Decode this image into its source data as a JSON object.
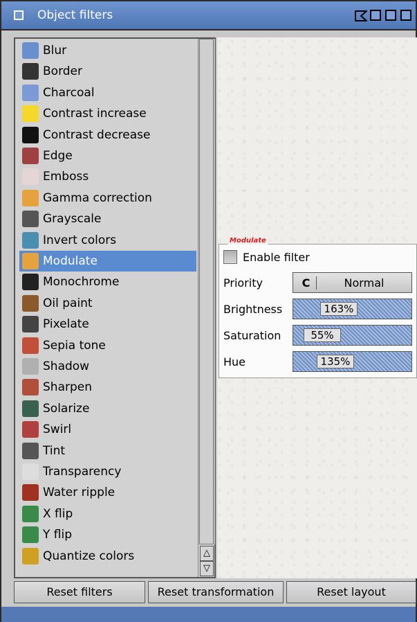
{
  "window": {
    "title": "Object filters"
  },
  "list": {
    "items": [
      {
        "label": "Blur",
        "icon": "blur-icon",
        "color": "#6a8fcf"
      },
      {
        "label": "Border",
        "icon": "border-icon",
        "color": "#333333"
      },
      {
        "label": "Charcoal",
        "icon": "charcoal-icon",
        "color": "#7b9ad6"
      },
      {
        "label": "Contrast increase",
        "icon": "contrast-increase-icon",
        "color": "#f4d92b"
      },
      {
        "label": "Contrast decrease",
        "icon": "contrast-decrease-icon",
        "color": "#111111"
      },
      {
        "label": "Edge",
        "icon": "edge-icon",
        "color": "#a04040"
      },
      {
        "label": "Emboss",
        "icon": "emboss-icon",
        "color": "#e5d5d5"
      },
      {
        "label": "Gamma correction",
        "icon": "gamma-icon",
        "color": "#e6a23c"
      },
      {
        "label": "Grayscale",
        "icon": "grayscale-icon",
        "color": "#555555"
      },
      {
        "label": "Invert colors",
        "icon": "invert-icon",
        "color": "#4a8fb0"
      },
      {
        "label": "Modulate",
        "icon": "modulate-icon",
        "color": "#e6a23c"
      },
      {
        "label": "Monochrome",
        "icon": "monochrome-icon",
        "color": "#222222"
      },
      {
        "label": "Oil paint",
        "icon": "oil-paint-icon",
        "color": "#8a5a2a"
      },
      {
        "label": "Pixelate",
        "icon": "pixelate-icon",
        "color": "#444444"
      },
      {
        "label": "Sepia tone",
        "icon": "sepia-icon",
        "color": "#c0503a"
      },
      {
        "label": "Shadow",
        "icon": "shadow-icon",
        "color": "#b0b0b0"
      },
      {
        "label": "Sharpen",
        "icon": "sharpen-icon",
        "color": "#b0503a"
      },
      {
        "label": "Solarize",
        "icon": "solarize-icon",
        "color": "#3a6050"
      },
      {
        "label": "Swirl",
        "icon": "swirl-icon",
        "color": "#b04040"
      },
      {
        "label": "Tint",
        "icon": "tint-icon",
        "color": "#555555"
      },
      {
        "label": "Transparency",
        "icon": "transparency-icon",
        "color": "#dddddd"
      },
      {
        "label": "Water ripple",
        "icon": "water-ripple-icon",
        "color": "#a03020"
      },
      {
        "label": "X flip",
        "icon": "x-flip-icon",
        "color": "#3a8a4a"
      },
      {
        "label": "Y flip",
        "icon": "y-flip-icon",
        "color": "#3a8a4a"
      },
      {
        "label": "Quantize colors",
        "icon": "quantize-icon",
        "color": "#d0a020"
      }
    ],
    "selected_index": 10
  },
  "filter_panel": {
    "group_title": "Modulate",
    "enable_label": "Enable filter",
    "priority_label": "Priority",
    "priority_value": "Normal",
    "brightness_label": "Brightness",
    "brightness_value": "163%",
    "brightness_level": 0.32,
    "saturation_label": "Saturation",
    "saturation_value": "55%",
    "saturation_level": 0.11,
    "hue_label": "Hue",
    "hue_value": "135%",
    "hue_level": 0.27
  },
  "buttons": {
    "reset_filters": "Reset filters",
    "reset_transformation": "Reset transformation",
    "reset_layout": "Reset layout"
  },
  "colors": {
    "titlebar": "#5b82c2",
    "selection": "#5a8bd0"
  }
}
